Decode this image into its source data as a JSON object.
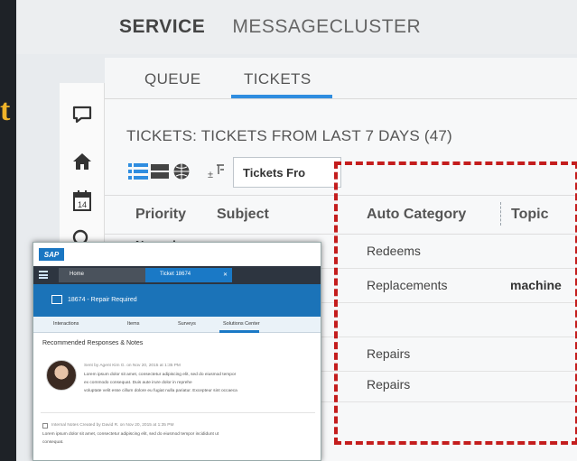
{
  "background": {
    "glyph": "t"
  },
  "header": {
    "service_label": "SERVICE",
    "cluster_label": "MESSAGECLUSTER"
  },
  "rail": {
    "icons": [
      "chat-icon",
      "home-icon",
      "calendar-icon",
      "search-icon"
    ],
    "calendar_day": "14"
  },
  "tabs": [
    {
      "label": "QUEUE",
      "active": false
    },
    {
      "label": "TICKETS",
      "active": true
    }
  ],
  "section_title": "TICKETS: TICKETS FROM LAST 7 DAYS (47)",
  "toolbar": {
    "filter_value": "Tickets Fro"
  },
  "table": {
    "headers": [
      "Priority",
      "Subject",
      "Auto Category",
      "Topic"
    ],
    "rows": [
      {
        "auto_category": "Redeems",
        "topic": ""
      },
      {
        "auto_category": "Replacements",
        "topic": "machine"
      },
      {
        "auto_category": "",
        "topic": ""
      },
      {
        "auto_category": "Repairs",
        "topic": ""
      },
      {
        "auto_category": "Repairs",
        "topic": ""
      }
    ],
    "partial_row": {
      "priority": "Normal"
    }
  },
  "popup": {
    "logo": "SAP",
    "home_tab": "Home",
    "ticket_tab": "Ticket 18674",
    "title": "18674 - Repair Required",
    "subtabs": [
      "Interactions",
      "Items",
      "Surveys",
      "Solutions Center"
    ],
    "section": "Recommended Responses & Notes",
    "response": {
      "meta": "Sent by Agent Kim G. on Nov 20, 2015 at 1:35 PM",
      "lines": [
        "Lorem ipsum dolor sit amet, consectetur adipiscing elit, sed do eiusmod tempor",
        "ex commodo consequat. Duis aute irure dolor in reprehe",
        "voluptate velit esse cillum dolore eu fugiat nulla pariatur. Excepteur sint occaeca"
      ]
    },
    "note": {
      "meta": "Internal Notes Created by David R. on Nov 20, 2015 at 1:35 PM",
      "lines": [
        "Lorem ipsum dolor sit amet, consectetur adipiscing elit, sed do eiusmod tempor incididunt ut",
        "consequat."
      ]
    }
  },
  "colors": {
    "accent": "#2f8de0",
    "highlight": "#c41d1d",
    "popup_header": "#1b73b8"
  }
}
